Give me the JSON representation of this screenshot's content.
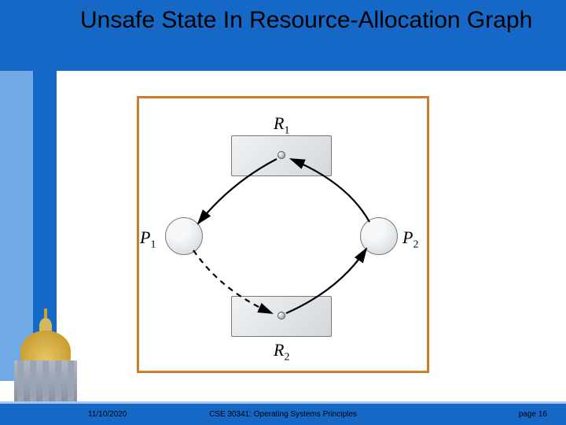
{
  "slide": {
    "title": "Unsafe State In Resource-Allocation Graph",
    "date": "11/10/2020",
    "course": "CSE 30341: Operating Systems Principles",
    "page_label": "page 16"
  },
  "diagram": {
    "resources": {
      "R1": {
        "name": "R",
        "sub": "1"
      },
      "R2": {
        "name": "R",
        "sub": "2"
      }
    },
    "processes": {
      "P1": {
        "name": "P",
        "sub": "1"
      },
      "P2": {
        "name": "P",
        "sub": "2"
      }
    }
  }
}
